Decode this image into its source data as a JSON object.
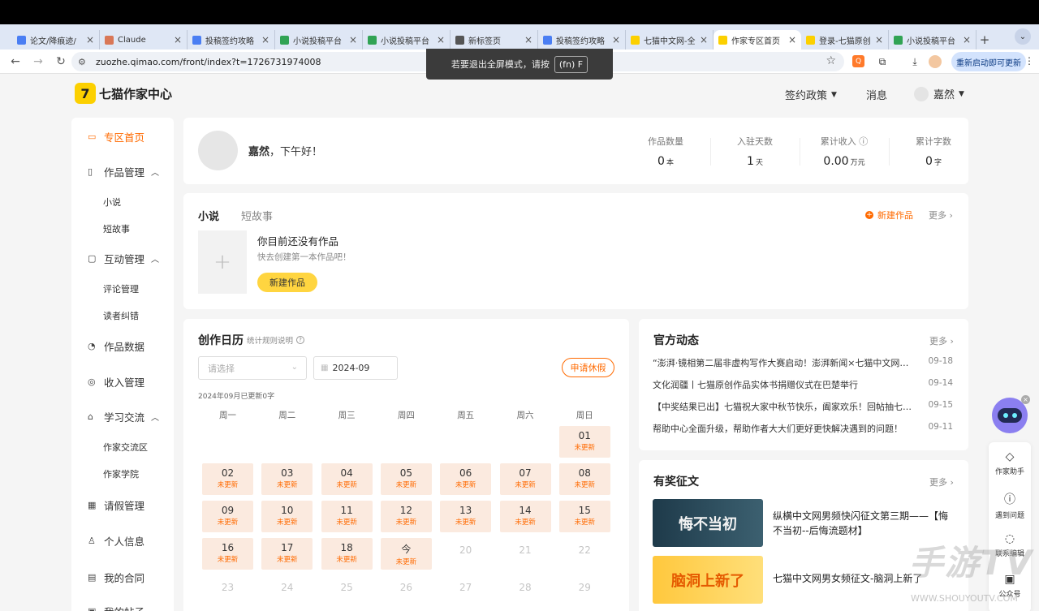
{
  "browser": {
    "tabs": [
      {
        "label": "论文/降痕迹/",
        "fav": "doc",
        "color": "#4a7ef3"
      },
      {
        "label": "Claude",
        "fav": "claude",
        "color": "#d97757"
      },
      {
        "label": "投稿签约攻略",
        "fav": "doc",
        "color": "#4a7ef3"
      },
      {
        "label": "小说投稿平台",
        "fav": "sheet",
        "color": "#31a354"
      },
      {
        "label": "小说投稿平台",
        "fav": "sheet",
        "color": "#31a354"
      },
      {
        "label": "新标签页",
        "fav": "chrome",
        "color": "#555555"
      },
      {
        "label": "投稿签约攻略",
        "fav": "doc",
        "color": "#4a7ef3"
      },
      {
        "label": "七猫中文网-全",
        "fav": "qimao",
        "color": "#fcd000"
      },
      {
        "label": "作家专区首页",
        "fav": "qimao",
        "color": "#fcd000"
      },
      {
        "label": "登录-七猫原创",
        "fav": "qimao",
        "color": "#fcd000"
      },
      {
        "label": "小说投稿平台",
        "fav": "sheet",
        "color": "#31a354"
      }
    ],
    "active_tab": 8,
    "url": "zuozhe.qimao.com/front/index?t=1726731974008",
    "relaunch_label": "重新启动即可更新",
    "fullscreen_toast": "若要退出全屏模式，请按",
    "fullscreen_key": "(fn) F"
  },
  "header": {
    "logo_mark": "7",
    "logo_text": "七猫作家中心",
    "sign_policy": "签约政策",
    "messages": "消息",
    "username": "嘉然"
  },
  "sidebar": {
    "home": "专区首页",
    "works": "作品管理",
    "works_novel": "小说",
    "works_short": "短故事",
    "interact": "互动管理",
    "comments": "评论管理",
    "errata": "读者纠错",
    "data": "作品数据",
    "income": "收入管理",
    "learn": "学习交流",
    "forum": "作家交流区",
    "academy": "作家学院",
    "leave": "请假管理",
    "profile": "个人信息",
    "contract": "我的合同",
    "posts": "我的帖子"
  },
  "profile": {
    "name": "嘉然",
    "greeting": "，下午好！",
    "stats": [
      {
        "label": "作品数量",
        "value": "0",
        "unit": "本"
      },
      {
        "label": "入驻天数",
        "value": "1",
        "unit": "天"
      },
      {
        "label": "累计收入 ⓘ",
        "value": "0.00",
        "unit": "万元"
      },
      {
        "label": "累计字数",
        "value": "0",
        "unit": "字"
      }
    ]
  },
  "works_card": {
    "tab_novel": "小说",
    "tab_short": "短故事",
    "new_work_link": "新建作品",
    "more": "更多",
    "empty_title": "你目前还没有作品",
    "empty_sub": "快去创建第一本作品吧！",
    "new_work_button": "新建作品"
  },
  "calendar": {
    "title": "创作日历",
    "rules": "统计规则说明",
    "select_placeholder": "请选择",
    "month": "2024-09",
    "apply_leave": "申请休假",
    "summary": "2024年09月已更新0字",
    "weekdays": [
      "周一",
      "周二",
      "周三",
      "周四",
      "周五",
      "周六",
      "周日"
    ],
    "status_label": "未更新",
    "today_label": "今",
    "days": [
      "01",
      "02",
      "03",
      "04",
      "05",
      "06",
      "07",
      "08",
      "09",
      "10",
      "11",
      "12",
      "13",
      "14",
      "15",
      "16",
      "17",
      "18",
      "今",
      "20",
      "21",
      "22",
      "23",
      "24",
      "25",
      "26",
      "27",
      "28",
      "29"
    ]
  },
  "news": {
    "title": "官方动态",
    "more": "更多",
    "items": [
      {
        "text": "“澎湃·镜相第二届非虚构写作大赛启动！澎湃新闻×七猫中文网联合工...",
        "date": "09-18"
      },
      {
        "text": "文化润疆丨七猫原创作品实体书捐赠仪式在巴楚举行",
        "date": "09-14"
      },
      {
        "text": "【中奖结果已出】七猫祝大家中秋节快乐，阖家欢乐！回帖抽七猫中...",
        "date": "09-15"
      },
      {
        "text": "帮助中心全面升级，帮助作者大大们更好更快解决遇到的问题！",
        "date": "09-11"
      }
    ]
  },
  "contests": {
    "title": "有奖征文",
    "more": "更多",
    "items": [
      {
        "banner": "悔不当初",
        "text": "纵横中文网男频快闪征文第三期——【悔不当初--后悔流题材】"
      },
      {
        "banner": "脑洞上新了",
        "text": "七猫中文网男女频征文-脑洞上新了"
      }
    ]
  },
  "floating": {
    "assistant": "作家助手",
    "problem": "遇到问题",
    "contact": "联系编辑",
    "official": "公众号"
  },
  "watermark": {
    "text": "手游TV",
    "url": "WWW.SHOUYOUTV.COM"
  }
}
